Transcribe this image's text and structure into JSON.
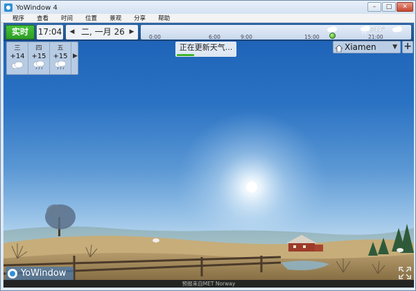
{
  "window": {
    "title": "YoWindow 4"
  },
  "menu": [
    "程序",
    "查看",
    "时间",
    "位置",
    "景观",
    "分享",
    "帮助"
  ],
  "topbar": {
    "now_label": "实时",
    "time": "17:04",
    "date": "二, 一月 26",
    "timeline_ticks": [
      "0:00",
      "6:00",
      "9:00",
      "15:00",
      "21:00"
    ],
    "timeline_temp": "+11°"
  },
  "forecast": [
    {
      "day": "三",
      "temp": "+14",
      "icon": "cloud-icon"
    },
    {
      "day": "四",
      "temp": "+15",
      "icon": "rain-cloud-icon"
    },
    {
      "day": "五",
      "temp": "+15",
      "icon": "rain-cloud-icon"
    }
  ],
  "status": {
    "text": "正在更新天气...",
    "progress": 0.3
  },
  "location": {
    "name": "Xiamen"
  },
  "brand": {
    "name": "YoWindow"
  },
  "credit": "预报来自MET Norway",
  "colors": {
    "accent_green": "#34a82a",
    "sky_top": "#1b5fb4",
    "toolbar": "#245a96"
  }
}
